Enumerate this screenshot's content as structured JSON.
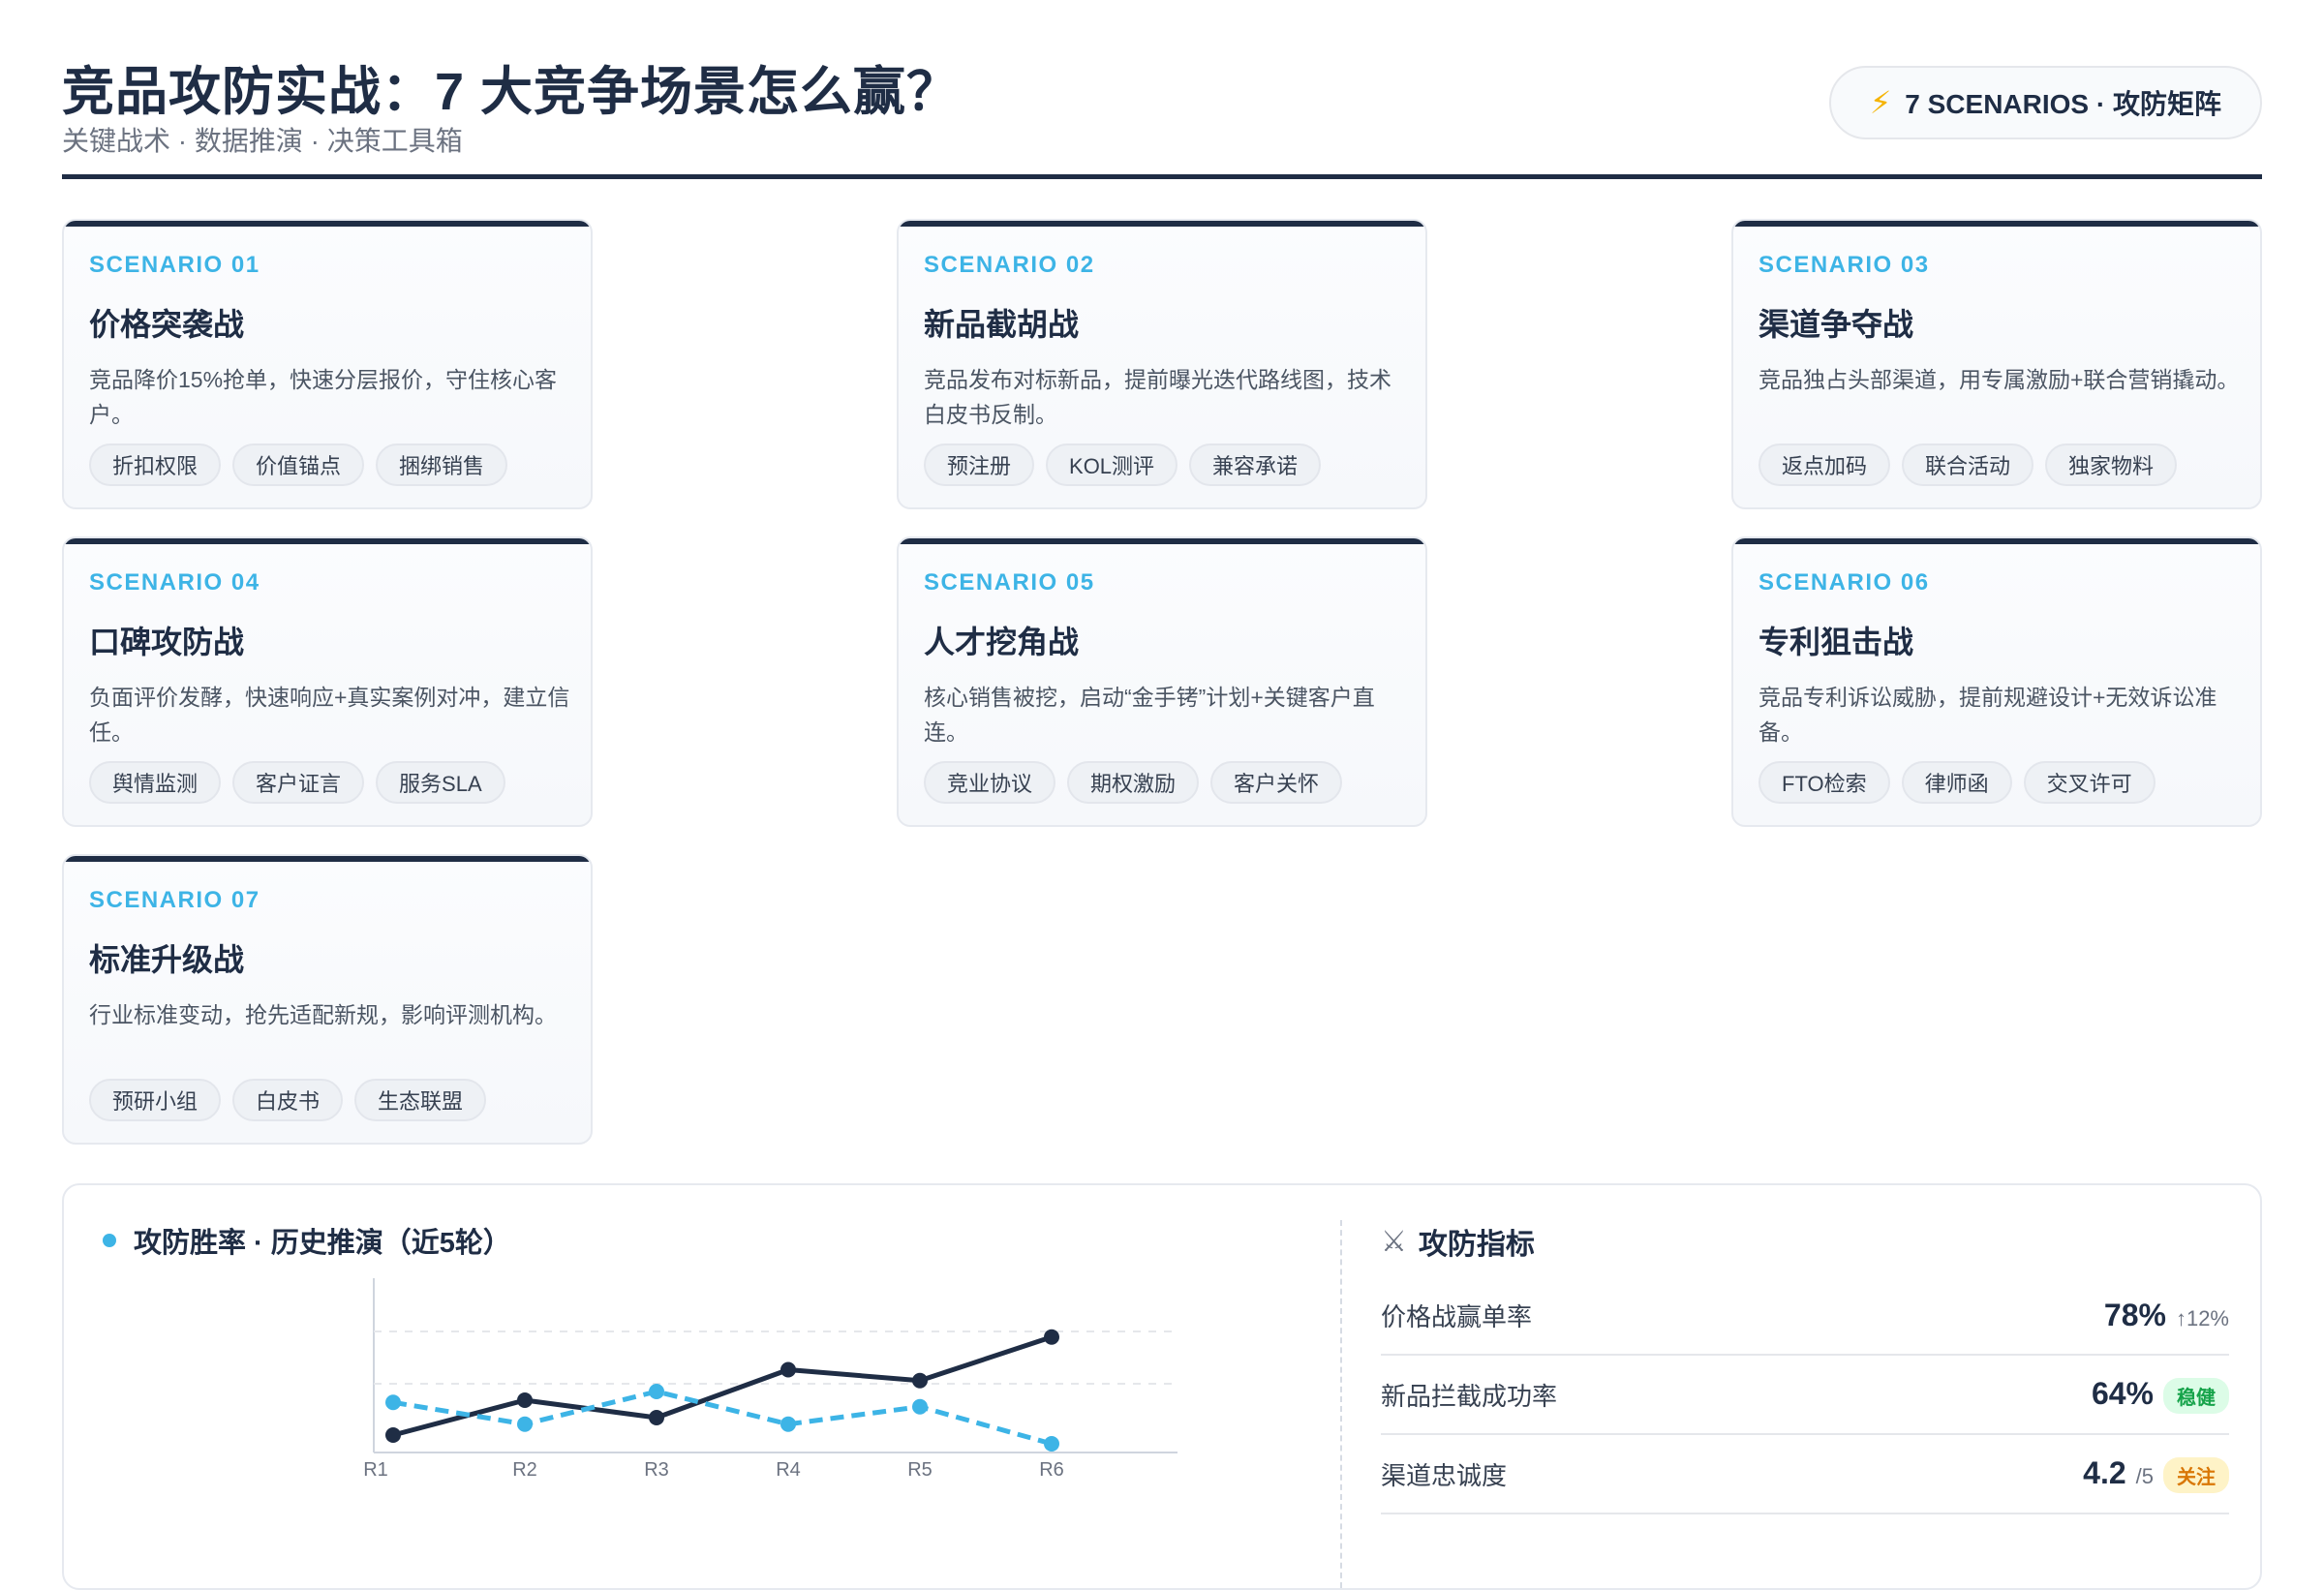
{
  "header": {
    "title": "竞品攻防实战：7 大竞争场景怎么赢？",
    "subtitle": "关键战术 · 数据推演 · 决策工具箱",
    "badge": "7 SCENARIOS · 攻防矩阵"
  },
  "scenarios": [
    {
      "code": "SCENARIO 01",
      "name": "价格突袭战",
      "desc": "竞品降价15%抢单，快速分层报价，守住核心客户。",
      "tags": [
        "折扣权限",
        "价值锚点",
        "捆绑销售"
      ]
    },
    {
      "code": "SCENARIO 02",
      "name": "新品截胡战",
      "desc": "竞品发布对标新品，提前曝光迭代路线图，技术白皮书反制。",
      "tags": [
        "预注册",
        "KOL测评",
        "兼容承诺"
      ]
    },
    {
      "code": "SCENARIO 03",
      "name": "渠道争夺战",
      "desc": "竞品独占头部渠道，用专属激励+联合营销撬动。",
      "tags": [
        "返点加码",
        "联合活动",
        "独家物料"
      ]
    },
    {
      "code": "SCENARIO 04",
      "name": "口碑攻防战",
      "desc": "负面评价发酵，快速响应+真实案例对冲，建立信任。",
      "tags": [
        "舆情监测",
        "客户证言",
        "服务SLA"
      ]
    },
    {
      "code": "SCENARIO 05",
      "name": "人才挖角战",
      "desc": "核心销售被挖，启动“金手铐”计划+关键客户直连。",
      "tags": [
        "竞业协议",
        "期权激励",
        "客户关怀"
      ]
    },
    {
      "code": "SCENARIO 06",
      "name": "专利狙击战",
      "desc": "竞品专利诉讼威胁，提前规避设计+无效诉讼准备。",
      "tags": [
        "FTO检索",
        "律师函",
        "交叉许可"
      ]
    },
    {
      "code": "SCENARIO 07",
      "name": "标准升级战",
      "desc": "行业标准变动，抢先适配新规，影响评测机构。",
      "tags": [
        "预研小组",
        "白皮书",
        "生态联盟"
      ]
    }
  ],
  "chart_panel": {
    "title": "攻防胜率 · 历史推演（近5轮）"
  },
  "chart_data": {
    "type": "line",
    "x": [
      "R1",
      "R2",
      "R3",
      "R4",
      "R5",
      "R6"
    ],
    "series": [
      {
        "values": [
          28,
          44,
          36,
          58,
          53,
          73
        ],
        "color": "#1f2d45",
        "style": "solid"
      },
      {
        "values": [
          43,
          33,
          48,
          33,
          41,
          24
        ],
        "color": "#3db4e6",
        "style": "dashed"
      }
    ],
    "ylim": [
      20,
      100
    ],
    "grid": true
  },
  "metrics": {
    "title": "攻防指标",
    "rows": [
      {
        "label": "价格战赢单率",
        "value": "78%",
        "unit": "",
        "note": "↑12%",
        "note_type": "trend"
      },
      {
        "label": "新品拦截成功率",
        "value": "64%",
        "unit": "",
        "note": "稳健",
        "note_type": "green"
      },
      {
        "label": "渠道忠诚度",
        "value": "4.2",
        "unit": "/5",
        "note": "关注",
        "note_type": "amber"
      }
    ]
  },
  "colors": {
    "accent": "#3db4e6",
    "navy": "#1f2d45",
    "bolt": "#f5b301"
  },
  "icons": {
    "badge": "lightning-icon",
    "metrics": "crossed-swords-icon"
  }
}
